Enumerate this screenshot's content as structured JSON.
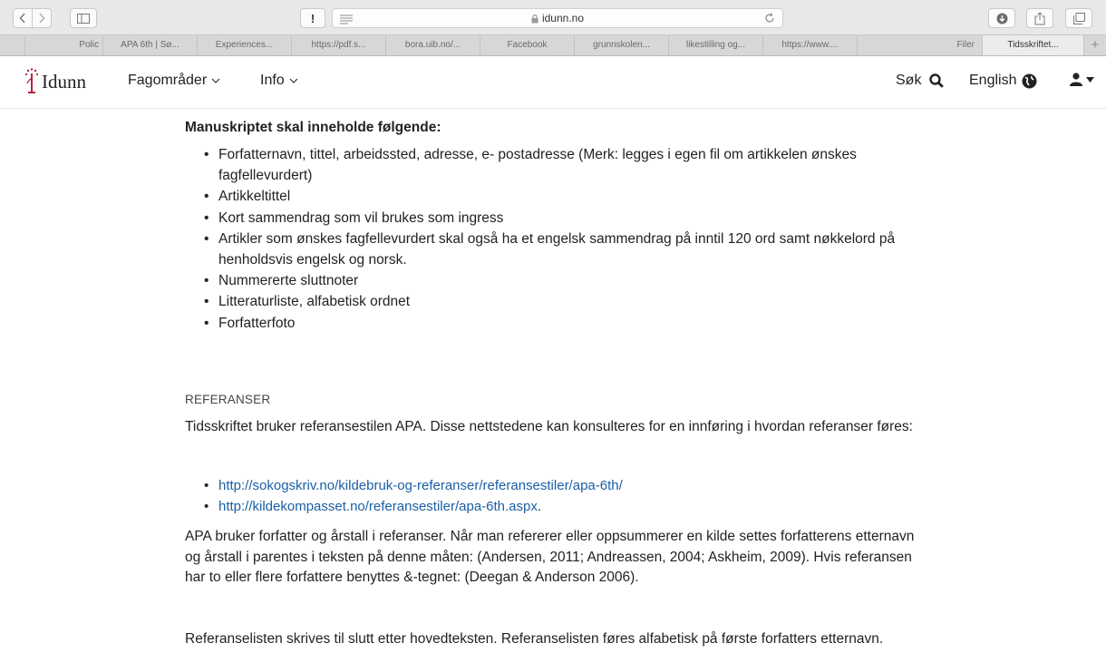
{
  "browser": {
    "url": "idunn.no",
    "tabs": [
      {
        "label": "Polic"
      },
      {
        "label": "APA 6th | Sø..."
      },
      {
        "label": "Experiences..."
      },
      {
        "label": "https://pdf.s..."
      },
      {
        "label": "bora.uib.no/..."
      },
      {
        "label": "Facebook"
      },
      {
        "label": "grunnskolen..."
      },
      {
        "label": "likestilling og..."
      },
      {
        "label": "https://www...."
      },
      {
        "label": "Filer"
      },
      {
        "label": "Tidsskriftet..."
      }
    ],
    "new_tab_label": "+"
  },
  "header": {
    "logo_text": "Idunn",
    "nav": [
      {
        "label": "Fagområder"
      },
      {
        "label": "Info"
      }
    ],
    "search_label": "Søk",
    "language_label": "English"
  },
  "content": {
    "heading": "Manuskriptet skal inneholde følgende:",
    "requirements": [
      "Forfatternavn, tittel, arbeidssted, adresse, e- postadresse (Merk: legges i egen fil om artikkelen ønskes fagfellevurdert)",
      "Artikkeltittel",
      "Kort sammendrag som vil brukes som ingress",
      "Artikler som ønskes fagfellevurdert skal også ha et engelsk sammendrag på inntil 120 ord samt nøkkelord på henholdsvis engelsk og norsk.",
      "Nummererte sluttnoter",
      "Litteraturliste, alfabetisk ordnet",
      "Forfatterfoto"
    ],
    "references_label": "REFERANSER",
    "references_intro": "Tidsskriftet bruker referansestilen APA. Disse nettstedene kan konsulteres for en innføring i hvordan referanser føres:",
    "links": [
      {
        "text": "http://sokogskriv.no/kildebruk-og-referanser/referansestiler/apa-6th/",
        "suffix": ""
      },
      {
        "text": "http://kildekompasset.no/referansestiler/apa-6th.aspx",
        "suffix": "."
      }
    ],
    "apa_paragraph": "APA bruker forfatter og årstall i referanser. Når man refererer eller oppsummerer en kilde settes forfatterens etternavn og årstall i parentes i teksten på denne måten: (Andersen, 2011; Andreassen, 2004; Askheim, 2009). Hvis referansen har to eller flere forfattere benyttes &-tegnet: (Deegan & Anderson 2006).",
    "list_paragraph": "Referanselisten skrives til slutt etter hovedteksten. Referanselisten føres alfabetisk på første forfatters etternavn."
  }
}
